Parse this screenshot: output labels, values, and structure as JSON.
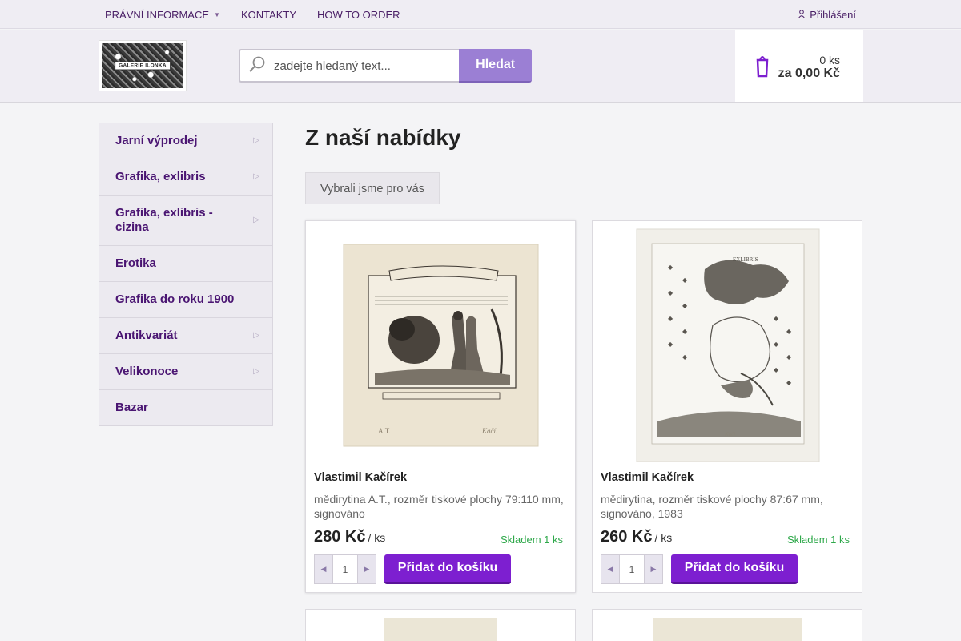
{
  "topnav": {
    "items": [
      {
        "label": "PRÁVNÍ INFORMACE",
        "has_dropdown": true
      },
      {
        "label": "KONTAKTY"
      },
      {
        "label": "HOW TO ORDER"
      }
    ],
    "login_label": "Přihlášení"
  },
  "header": {
    "logo_text": "GALERIE ILONKA",
    "search": {
      "placeholder": "zadejte hledaný text...",
      "button_label": "Hledat"
    },
    "cart": {
      "qty": "0 ks",
      "total": "za 0,00 Kč"
    }
  },
  "sidebar": {
    "items": [
      {
        "label": "Jarní výprodej",
        "has_sub": true
      },
      {
        "label": "Grafika, exlibris",
        "has_sub": true
      },
      {
        "label": "Grafika, exlibris - cizina",
        "has_sub": true
      },
      {
        "label": "Erotika",
        "has_sub": false
      },
      {
        "label": "Grafika do roku 1900",
        "has_sub": false
      },
      {
        "label": "Antikvariát",
        "has_sub": true
      },
      {
        "label": "Velikonoce",
        "has_sub": true
      },
      {
        "label": "Bazar",
        "has_sub": false
      }
    ]
  },
  "main": {
    "title": "Z naší nabídky",
    "tabs": [
      {
        "label": "Vybrali jsme pro vás"
      }
    ],
    "products": [
      {
        "author": "Vlastimil Kačírek",
        "description": "mědirytina A.T., rozměr tiskové plochy 79:110 mm, signováno",
        "price": "280 Kč",
        "unit": "/ ks",
        "stock": "Skladem 1 ks",
        "quantity": "1",
        "add_label": "Přidat do košíku",
        "image_icon": "exlibris-etching-couple-image"
      },
      {
        "author": "Vlastimil Kačírek",
        "description": "mědirytina, rozměr tiskové plochy 87:67 mm, signováno, 1983",
        "price": "260 Kč",
        "unit": "/ ks",
        "stock": "Skladem 1 ks",
        "quantity": "1",
        "add_label": "Přidat do košíku",
        "image_icon": "exlibris-etching-europe-map-image"
      }
    ]
  },
  "colors": {
    "accent": "#7d1fd0",
    "search_button": "#9b7fd4",
    "sidebar_text": "#4a1572",
    "stock_green": "#2ea84a"
  }
}
